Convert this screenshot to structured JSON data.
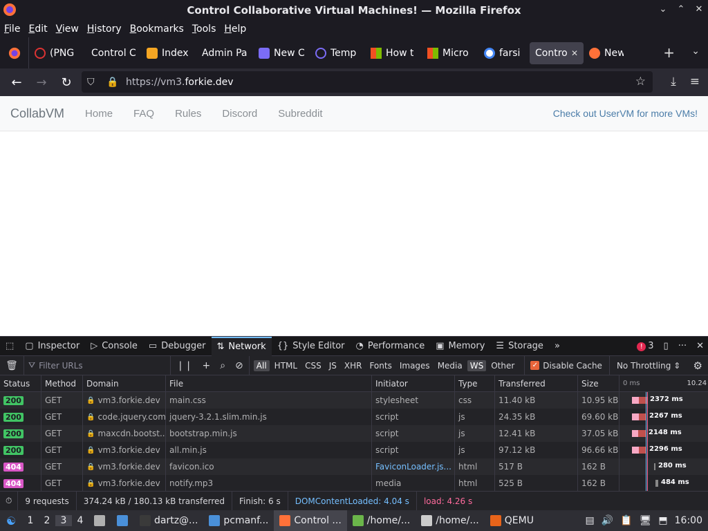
{
  "window": {
    "title": "Control Collaborative Virtual Machines! — Mozilla Firefox",
    "controls": [
      "⌄",
      "⌃",
      "✕"
    ]
  },
  "menu": [
    "File",
    "Edit",
    "View",
    "History",
    "Bookmarks",
    "Tools",
    "Help"
  ],
  "tabs": [
    {
      "label": "(PNG",
      "icon": "#d33",
      "icon_name": "broken-page-icon"
    },
    {
      "label": "Control C",
      "icon": "",
      "icon_name": ""
    },
    {
      "label": "Index",
      "icon": "#f5a623",
      "icon_name": "puzzle-icon"
    },
    {
      "label": "Admin Pa",
      "icon": "",
      "icon_name": ""
    },
    {
      "label": "New C",
      "icon": "#7b6cf6",
      "icon_name": "extension-icon"
    },
    {
      "label": "Temp",
      "icon": "#7b6cf6",
      "icon_name": "at-icon"
    },
    {
      "label": "How t",
      "icon": "#f25022",
      "icon_name": "microsoft-icon"
    },
    {
      "label": "Micro",
      "icon": "#f25022",
      "icon_name": "microsoft-icon"
    },
    {
      "label": "farsi",
      "icon": "#4285f4",
      "icon_name": "google-icon"
    },
    {
      "label": "Contro",
      "icon": "",
      "icon_name": "",
      "active": true
    },
    {
      "label": "New T",
      "icon": "#ff7139",
      "icon_name": "firefox-icon"
    }
  ],
  "nav": {
    "url_prefix": "https://vm3.",
    "url_domain": "forkie.dev"
  },
  "site": {
    "brand": "CollabVM",
    "links": [
      "Home",
      "FAQ",
      "Rules",
      "Discord",
      "Subreddit"
    ],
    "uservm": "Check out UserVM for more VMs!"
  },
  "devtools": {
    "tabs": [
      "Inspector",
      "Console",
      "Debugger",
      "Network",
      "Style Editor",
      "Performance",
      "Memory",
      "Storage"
    ],
    "active_tab": "Network",
    "error_count": "3",
    "filter_placeholder": "Filter URLs",
    "types": [
      "All",
      "HTML",
      "CSS",
      "JS",
      "XHR",
      "Fonts",
      "Images",
      "Media",
      "WS",
      "Other"
    ],
    "disable_cache": "Disable Cache",
    "throttling": "No Throttling ⇕",
    "columns": [
      "Status",
      "Method",
      "Domain",
      "File",
      "Initiator",
      "Type",
      "Transferred",
      "Size"
    ],
    "waterfall_ticks": [
      "0 ms",
      "10.24"
    ],
    "rows": [
      {
        "status": "200",
        "method": "GET",
        "domain": "vm3.forkie.dev",
        "file": "main.css",
        "initiator": "stylesheet",
        "type": "css",
        "transferred": "11.40 kB",
        "size": "10.95 kB",
        "time": "2372 ms"
      },
      {
        "status": "200",
        "method": "GET",
        "domain": "code.jquery.com",
        "file": "jquery-3.2.1.slim.min.js",
        "initiator": "script",
        "type": "js",
        "transferred": "24.35 kB",
        "size": "69.60 kB",
        "time": "2267 ms"
      },
      {
        "status": "200",
        "method": "GET",
        "domain": "maxcdn.bootst...",
        "file": "bootstrap.min.js",
        "initiator": "script",
        "type": "js",
        "transferred": "12.41 kB",
        "size": "37.05 kB",
        "time": "2148 ms"
      },
      {
        "status": "200",
        "method": "GET",
        "domain": "vm3.forkie.dev",
        "file": "all.min.js",
        "initiator": "script",
        "type": "js",
        "transferred": "97.12 kB",
        "size": "96.66 kB",
        "time": "2296 ms"
      },
      {
        "status": "404",
        "method": "GET",
        "domain": "vm3.forkie.dev",
        "file": "favicon.ico",
        "initiator": "FaviconLoader.js...",
        "type": "html",
        "transferred": "517 B",
        "size": "162 B",
        "time": "280 ms"
      },
      {
        "status": "404",
        "method": "GET",
        "domain": "vm3.forkie.dev",
        "file": "notify.mp3",
        "initiator": "media",
        "type": "html",
        "transferred": "525 B",
        "size": "162 B",
        "time": "484 ms"
      }
    ],
    "summary": {
      "requests": "9 requests",
      "transferred": "374.24 kB / 180.13 kB transferred",
      "finish": "Finish: 6 s",
      "dcl": "DOMContentLoaded: 4.04 s",
      "load": "load: 4.26 s"
    }
  },
  "taskbar": {
    "workspaces": [
      "1",
      "2",
      "3",
      "4"
    ],
    "active_workspace": "3",
    "items": [
      {
        "label": "dartz@...",
        "color": "#3a3a3a"
      },
      {
        "label": "pcmanf...",
        "color": "#4a90d9"
      },
      {
        "label": "Control ...",
        "color": "#ff7139",
        "active": true
      },
      {
        "label": "/home/...",
        "color": "#6bb54a"
      },
      {
        "label": "/home/...",
        "color": "#cccccc"
      },
      {
        "label": "QEMU",
        "color": "#e8641a"
      }
    ],
    "clock": "16:00"
  }
}
